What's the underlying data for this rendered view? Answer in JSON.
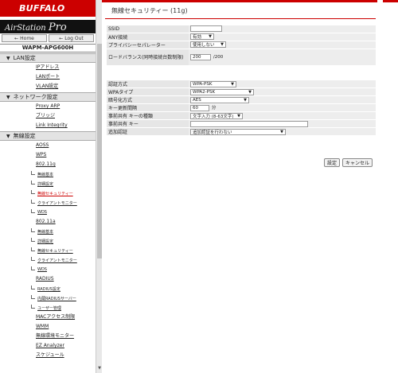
{
  "sidebar": {
    "logo": "BUFFALO",
    "product": "AirStation",
    "product_suffix": "Pro",
    "home_button": "Home",
    "logout_button": "Log Out",
    "model": "WAPM-APG600H",
    "sections": [
      {
        "label": "LAN設定",
        "items": [
          "IPアドレス",
          "LANポート",
          "VLAN設定"
        ]
      },
      {
        "label": "ネットワーク設定",
        "items": [
          "Proxy ARP",
          "ブリッジ",
          "Link Integrity"
        ]
      },
      {
        "label": "無線設定",
        "items": [
          "AOSS",
          "WPS",
          "802.11g"
        ]
      }
    ],
    "g_subitems": [
      "無線基本",
      "詳細設定",
      "無線セキュリティー",
      "クライアントモニター",
      "WDS"
    ],
    "a_label": "802.11a",
    "a_subitems": [
      "無線基本",
      "詳細設定",
      "無線セキュリティー",
      "クライアントモニター",
      "WDS"
    ],
    "radius_label": "RADIUS",
    "radius_subitems": [
      "RADIUS設定",
      "内蔵RADIUSサーバー",
      "ユーザー管理"
    ],
    "bottom_items": [
      "MACアクセス制限",
      "WMM",
      "無線環境モニター",
      "EZ Analyzer",
      "スケジュール"
    ]
  },
  "main": {
    "title": "無線セキュリティー (11g)",
    "rows1": [
      {
        "label": "SSID",
        "value": ""
      },
      {
        "label": "ANY接続",
        "value": "有効"
      },
      {
        "label": "プライバシーセパレーター",
        "value": "使用しない"
      },
      {
        "label": "ロードバランス(同時接続台数制限)",
        "value": "200",
        "unit": "/200"
      }
    ],
    "rows2": [
      {
        "label": "認証方式",
        "value": "WPA-PSK"
      },
      {
        "label": "WPAタイプ",
        "value": "WPA2-PSK"
      },
      {
        "label": "暗号化方式",
        "value": "AES"
      },
      {
        "label": "キー更新間隔",
        "value": "60",
        "unit": "分"
      },
      {
        "label": "事前共有 キーの種類",
        "value": "文字入力 (8-63文字)"
      },
      {
        "label": "事前共有 キー",
        "value": ""
      },
      {
        "label": "追加認証",
        "value": "追加認証を行わない"
      }
    ],
    "apply_button": "設定",
    "cancel_button": "キャンセル"
  },
  "colors": {
    "brand": "#cc0000",
    "label_bg": "#e6e6e6",
    "value_bg": "#ededed"
  }
}
